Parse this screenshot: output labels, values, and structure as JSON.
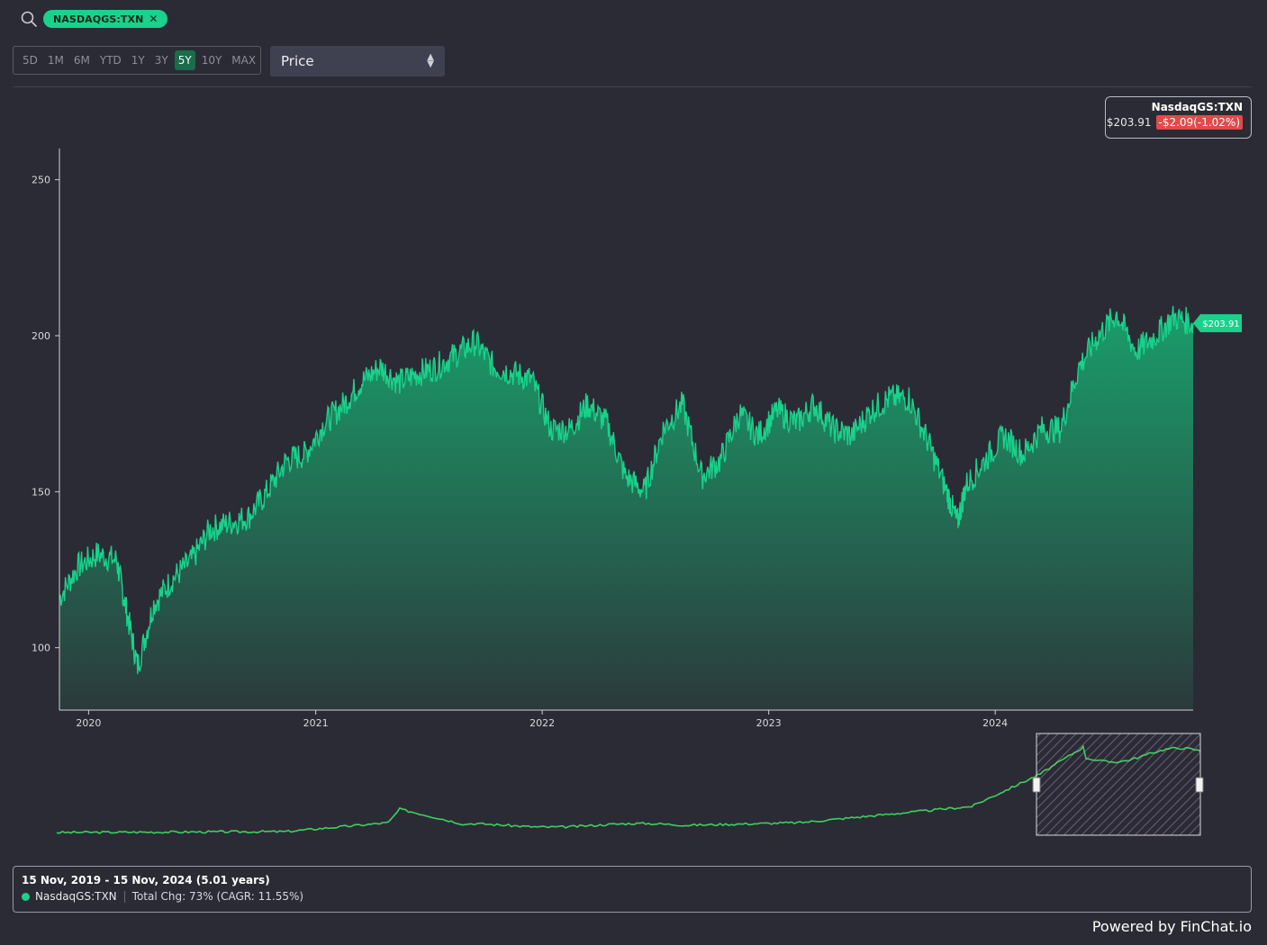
{
  "search": {
    "icon": "search-icon"
  },
  "ticker": {
    "label": "NASDAQGS:TXN",
    "remove": "✕"
  },
  "ranges": [
    "5D",
    "1M",
    "6M",
    "YTD",
    "1Y",
    "3Y",
    "5Y",
    "10Y",
    "MAX"
  ],
  "active_range": "5Y",
  "metric": {
    "value": "Price"
  },
  "info": {
    "name": "NasdaqGS:TXN",
    "price": "$203.91",
    "change": "-$2.09(-1.02%)"
  },
  "colors": {
    "accent": "#19d28b",
    "negative": "#e24a4a",
    "background": "#2b2b35",
    "navigator_line": "#3ecf5e",
    "navigator_window": "#c79bd0"
  },
  "footer": {
    "period": "15 Nov, 2019 - 15 Nov, 2024 (5.01 years)",
    "series": "NasdaqGS:TXN",
    "total_change": "Total Chg: 73% (CAGR: 11.55%)"
  },
  "powered_by": "Powered by FinChat.io",
  "chart_data": {
    "type": "area",
    "title": "",
    "xlabel": "",
    "ylabel": "",
    "x_ticks": [
      "2020",
      "2021",
      "2022",
      "2023",
      "2024"
    ],
    "y_ticks": [
      100,
      150,
      200,
      250
    ],
    "ylim": [
      80,
      260
    ],
    "xlim": [
      "2019-11-15",
      "2024-11-15"
    ],
    "last_label": "$203.91",
    "series": [
      {
        "name": "NasdaqGS:TXN",
        "x": [
          "2019-11-15",
          "2019-12-15",
          "2020-01-15",
          "2020-02-15",
          "2020-03-01",
          "2020-03-20",
          "2020-04-15",
          "2020-05-15",
          "2020-06-15",
          "2020-07-15",
          "2020-08-15",
          "2020-09-15",
          "2020-10-15",
          "2020-11-15",
          "2020-12-15",
          "2021-01-15",
          "2021-02-15",
          "2021-03-15",
          "2021-04-15",
          "2021-05-15",
          "2021-06-15",
          "2021-07-15",
          "2021-08-15",
          "2021-09-15",
          "2021-10-15",
          "2021-11-15",
          "2021-12-15",
          "2022-01-15",
          "2022-02-15",
          "2022-03-15",
          "2022-04-15",
          "2022-05-15",
          "2022-06-15",
          "2022-07-15",
          "2022-08-15",
          "2022-09-15",
          "2022-10-15",
          "2022-11-15",
          "2022-12-15",
          "2023-01-15",
          "2023-02-15",
          "2023-03-15",
          "2023-04-15",
          "2023-05-15",
          "2023-06-15",
          "2023-07-15",
          "2023-08-15",
          "2023-09-15",
          "2023-10-15",
          "2023-11-01",
          "2023-11-15",
          "2023-12-15",
          "2024-01-15",
          "2024-02-15",
          "2024-03-15",
          "2024-04-15",
          "2024-05-15",
          "2024-06-15",
          "2024-07-15",
          "2024-08-15",
          "2024-09-15",
          "2024-10-15",
          "2024-11-15"
        ],
        "values": [
          116,
          126,
          130,
          128,
          113,
          94,
          114,
          122,
          128,
          138,
          140,
          142,
          150,
          160,
          162,
          172,
          178,
          185,
          190,
          185,
          188,
          190,
          194,
          198,
          190,
          188,
          186,
          170,
          170,
          178,
          172,
          155,
          150,
          170,
          178,
          155,
          160,
          175,
          168,
          176,
          172,
          178,
          170,
          168,
          176,
          180,
          180,
          166,
          150,
          140,
          152,
          160,
          168,
          162,
          170,
          170,
          190,
          200,
          207,
          195,
          200,
          206,
          204
        ]
      }
    ]
  }
}
